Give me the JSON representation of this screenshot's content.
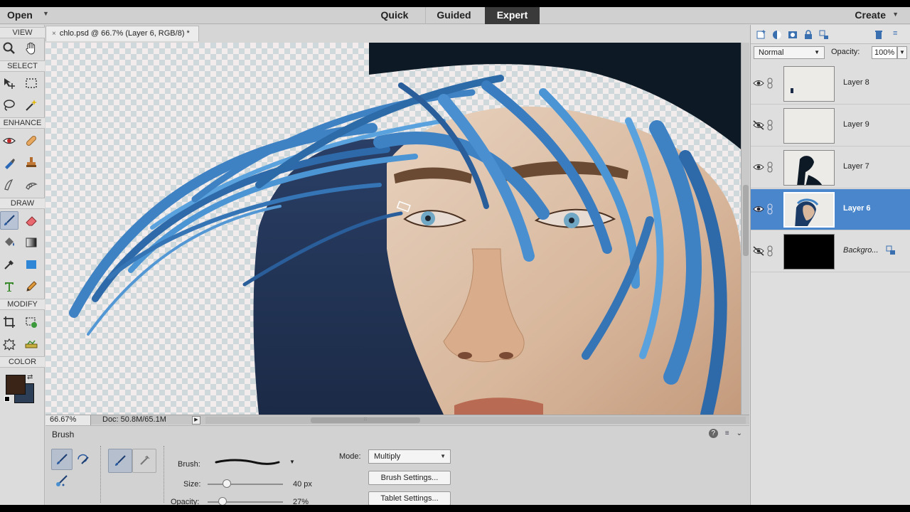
{
  "topbar": {
    "open_label": "Open",
    "modes": [
      {
        "label": "Quick",
        "active": false
      },
      {
        "label": "Guided",
        "active": false
      },
      {
        "label": "Expert",
        "active": true
      }
    ],
    "create_label": "Create"
  },
  "toolbox": {
    "sections": [
      "VIEW",
      "SELECT",
      "ENHANCE",
      "DRAW",
      "MODIFY",
      "COLOR"
    ],
    "tools": {
      "view": [
        "zoom-icon",
        "hand-icon"
      ],
      "select": [
        "move-icon",
        "marquee-icon",
        "lasso-icon",
        "magic-wand-icon"
      ],
      "enhance": [
        "red-eye-icon",
        "spot-healing-icon",
        "sponge-icon",
        "clone-stamp-icon",
        "blur-icon",
        "smudge-icon"
      ],
      "draw": [
        "brush-icon",
        "eraser-icon",
        "paint-bucket-icon",
        "gradient-icon",
        "eyedropper-icon",
        "shape-icon",
        "type-icon",
        "pencil-icon"
      ],
      "modify": [
        "crop-icon",
        "recompose-icon",
        "content-aware-move-icon",
        "straighten-icon"
      ]
    },
    "foreground_color": "#3a2418",
    "background_color": "#2d3e57"
  },
  "document": {
    "tab_title": "chlo.psd @ 66.7% (Layer 6, RGB/8) *",
    "zoom": "66.67%",
    "doc_size": "Doc: 50.8M/65.1M"
  },
  "tool_options": {
    "title": "Brush",
    "brush_label": "Brush:",
    "size_label": "Size:",
    "size_value": "40 px",
    "size_fraction": 0.25,
    "opacity_label": "Opacity:",
    "opacity_value": "27%",
    "opacity_fraction": 0.2,
    "mode_label": "Mode:",
    "mode_value": "Multiply",
    "brush_settings_label": "Brush Settings...",
    "tablet_settings_label": "Tablet Settings..."
  },
  "layers_panel": {
    "blend_mode": "Normal",
    "opacity_label": "Opacity:",
    "opacity_value": "100%",
    "layers": [
      {
        "name": "Layer 8",
        "visible": true,
        "selected": false,
        "locked": false
      },
      {
        "name": "Layer 9",
        "visible": false,
        "selected": false,
        "locked": false
      },
      {
        "name": "Layer 7",
        "visible": true,
        "selected": false,
        "locked": false
      },
      {
        "name": "Layer 6",
        "visible": true,
        "selected": true,
        "locked": false
      },
      {
        "name": "Backgro...",
        "visible": false,
        "selected": false,
        "locked": true
      }
    ]
  },
  "colors": {
    "accent": "#4a86cc",
    "expert_tab": "#3a3a3a",
    "hair_blue": "#3f82c4",
    "skin": "#d8b79c"
  }
}
